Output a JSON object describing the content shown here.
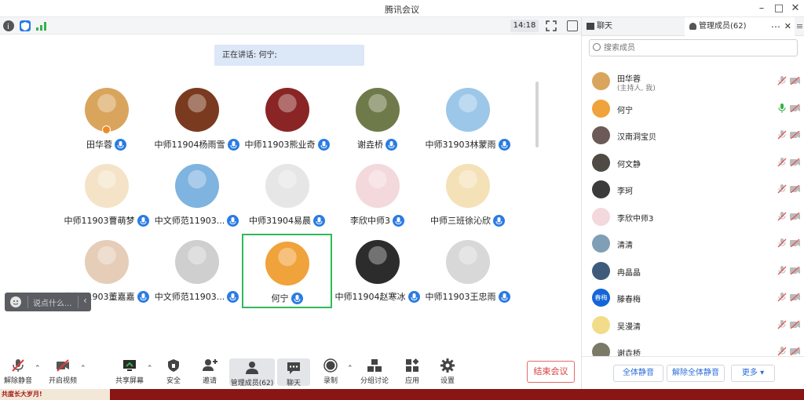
{
  "window": {
    "title": "腾讯会议"
  },
  "infobar": {
    "time": "14:18"
  },
  "main": {
    "speaking": "正在讲话: 何宁;",
    "participants": [
      {
        "name": "田华蓉",
        "avatar_color": "#d9a55d",
        "host": true
      },
      {
        "name": "中师11904杨雨雪",
        "avatar_color": "#7a3a1f"
      },
      {
        "name": "中师11903熊业奇",
        "avatar_color": "#8a2525"
      },
      {
        "name": "谢垚桥",
        "avatar_color": "#6f7a4a"
      },
      {
        "name": "中师31903林蒙雨",
        "avatar_color": "#9cc7e8"
      },
      {
        "name": "中师11903曹萌梦",
        "avatar_color": "#f4e3c7"
      },
      {
        "name": "中文师范11903...",
        "avatar_color": "#7fb3e0"
      },
      {
        "name": "中师31904易晨",
        "avatar_color": "#e6e6e6"
      },
      {
        "name": "李欣中师3",
        "avatar_color": "#f3d8dc"
      },
      {
        "name": "中师三班徐沁欣",
        "avatar_color": "#f5e1b8"
      },
      {
        "name": "中师31903董嘉嘉",
        "avatar_color": "#e5cdb8"
      },
      {
        "name": "中文师范11903...",
        "avatar_color": "#cfcfcf"
      },
      {
        "name": "何宁",
        "avatar_color": "#f0a23b",
        "speaking": true
      },
      {
        "name": "中师11904赵寒冰",
        "avatar_color": "#2c2c2c"
      },
      {
        "name": "中师11903王忠雨",
        "avatar_color": "#d8d8d8"
      }
    ]
  },
  "chat_bubble": {
    "placeholder": "说点什么..."
  },
  "toolbar": {
    "unmute": "解除静音",
    "video": "开启视频",
    "share": "共享屏幕",
    "security": "安全",
    "invite": "邀请",
    "members": "管理成员(62)",
    "chat": "聊天",
    "record": "录制",
    "breakout": "分组讨论",
    "apps": "应用",
    "settings": "设置",
    "end": "结束会议"
  },
  "panel": {
    "tab_chat": "聊天",
    "tab_members": "管理成员(62)",
    "search_placeholder": "搜索成员",
    "members": [
      {
        "name": "田华蓉",
        "sub": "(主持人, 我)",
        "color": "#d9a55d",
        "mic": "muted"
      },
      {
        "name": "何宁",
        "color": "#f0a23b",
        "mic": "active"
      },
      {
        "name": "汉南洞宝贝",
        "color": "#6b5a57",
        "mic": "muted"
      },
      {
        "name": "何文静",
        "color": "#4f4a44",
        "mic": "muted"
      },
      {
        "name": "李珂",
        "color": "#3b3b3b",
        "mic": "muted"
      },
      {
        "name": "李欣中师3",
        "color": "#f3d8dc",
        "mic": "muted"
      },
      {
        "name": "清清",
        "color": "#7f9fb6",
        "mic": "muted"
      },
      {
        "name": "冉晶晶",
        "color": "#3e5b7b",
        "mic": "muted"
      },
      {
        "name": "滕春梅",
        "color": "#1565d8",
        "initials": "春梅",
        "mic": "muted"
      },
      {
        "name": "吴漫清",
        "color": "#f1dc8a",
        "mic": "muted"
      },
      {
        "name": "谢垚桥",
        "color": "#7a7a66",
        "mic": "muted"
      }
    ],
    "mute_all": "全体静音",
    "unmute_all": "解除全体静音",
    "more": "更多 ▾"
  },
  "bottom_poster": {
    "text": "共度长大岁月!"
  }
}
